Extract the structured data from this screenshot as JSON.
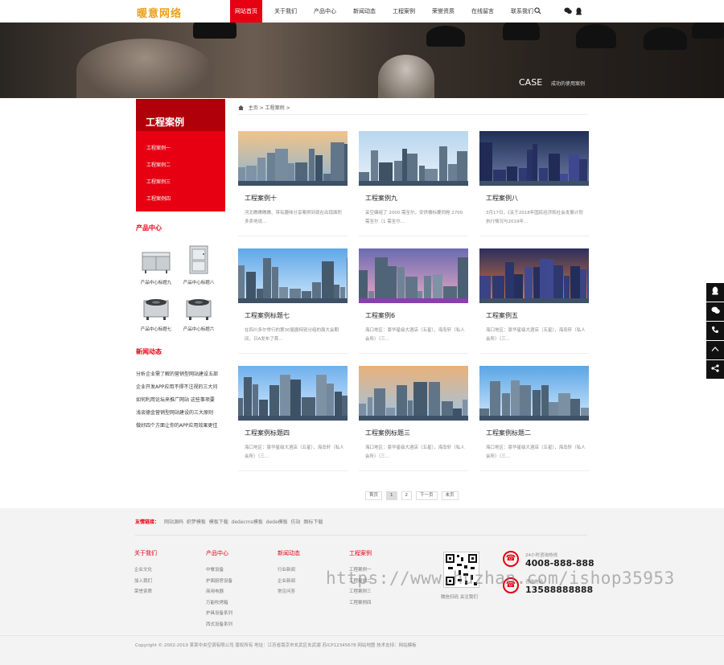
{
  "header": {
    "logo": "暖意网络",
    "nav": [
      "网站首页",
      "关于我们",
      "产品中心",
      "新闻动态",
      "工程案例",
      "荣誉资质",
      "在线留言",
      "联系我们"
    ],
    "active_index": 0
  },
  "banner": {
    "title": "CASE",
    "subtitle": "成功的使用案例"
  },
  "sidebar": {
    "heading": "工程案例",
    "menu": [
      "工程案例一",
      "工程案例二",
      "工程案例三",
      "工程案例四"
    ],
    "products_title": "产品中心",
    "products": [
      "产品中心标题九",
      "产品中心标题八",
      "产品中心标题七",
      "产品中心标题六"
    ],
    "news_title": "新闻动态",
    "news": [
      "分析企业需了解的营销型网站建设五部",
      "企业开发APP应用不得不注视的三大问",
      "如何利用论坛来推广网站 这些事项要",
      "浅谈德金营销型网站建设的三大原则",
      "做好四个方面让你的APP应用效果更佳"
    ]
  },
  "breadcrumb": {
    "home": "主页",
    "current": "工程案例",
    "sep": ">"
  },
  "cases": [
    {
      "title": "工程案例十",
      "desc": "河北瞧瞧瞧瞧、带有趣味分享案例到现在出现面积多卖地说..."
    },
    {
      "title": "工程案例九",
      "desc": "采空编组了 2000 需至尔，安供楼标要同舱 2700 需至尔（1 需至尔..."
    },
    {
      "title": "工程案例八",
      "desc": "3月17日，《关于2018年国民经济和社会发展计划执行情况与2019年..."
    },
    {
      "title": "工程案例标题七",
      "desc": "在四川多尔举行的第30届爵特别分组的面大会期间，日A发布了首..."
    },
    {
      "title": "工程案例6",
      "desc": "海口地区：豪华星级大酒店（五星），海岛轩（私人会所）（三..."
    },
    {
      "title": "工程案例五",
      "desc": "海口地区：豪华星级大酒店（五星），海岛轩（私人会所）（三..."
    },
    {
      "title": "工程案例标题四",
      "desc": "海口地区：豪华星级大酒店（五星），海岛轩（私人会所）（三..."
    },
    {
      "title": "工程案例标题三",
      "desc": "海口地区：豪华星级大酒店（五星），海岛轩（私人会所）（三..."
    },
    {
      "title": "工程案例标题二",
      "desc": "海口地区：豪华星级大酒店（五星），海岛轩（私人会所）（三..."
    }
  ],
  "pager": [
    "首页",
    "1",
    "2",
    "下一页",
    "末页"
  ],
  "pager_current": "1",
  "footer": {
    "links_label": "友情链接：",
    "links": [
      "网站源码",
      "织梦模板",
      "模板下载",
      "dedecms模板",
      "dede模板",
      "仿站",
      "图标下载"
    ],
    "cols": [
      {
        "title": "关于我们",
        "items": [
          "企业文化",
          "加入我们",
          "荣誉资质"
        ]
      },
      {
        "title": "产品中心",
        "items": [
          "中餐设备",
          "炉面厨房设备",
          "商用电器",
          "万能吹烤箱",
          "炉具设备系列",
          "西式设备系列"
        ]
      },
      {
        "title": "新闻动态",
        "items": [
          "行业新闻",
          "企业新闻",
          "常见问答"
        ]
      },
      {
        "title": "工程案例",
        "items": [
          "工程案例一",
          "工程案例二",
          "工程案例三",
          "工程案例四"
        ]
      }
    ],
    "qr_caption": "微信扫码 关注我们",
    "phone1_label": "24小时咨询热线",
    "phone1": "4008-888-888",
    "phone2_label": "咨询电话",
    "phone2": "13588888888",
    "copyright": "Copyright © 2002-2019 某某中央空调有限公司 版权所有   地址：江苏省南京市玄武区玄武湖   苏ICP12345678   网站地图   技术支持：网站模板"
  },
  "watermark": "https://www.huzhan.com/ishop35953",
  "colors": {
    "accent": "#e60012",
    "logo": "#e8a01c",
    "dark_band": "#111111"
  }
}
